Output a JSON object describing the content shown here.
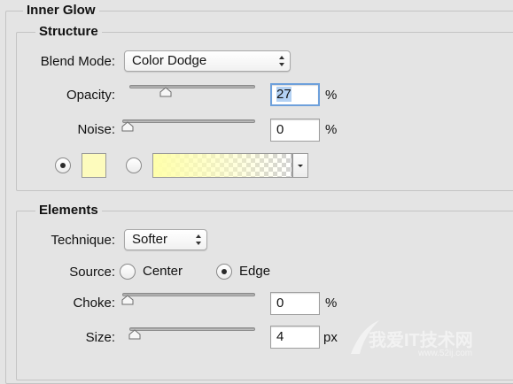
{
  "panel_title": "Inner Glow",
  "structure": {
    "title": "Structure",
    "blend_mode_label": "Blend Mode:",
    "blend_mode_value": "Color Dodge",
    "opacity_label": "Opacity:",
    "opacity_value": "27",
    "opacity_level": 0.27,
    "opacity_unit": "%",
    "noise_label": "Noise:",
    "noise_value": "0",
    "noise_level": 0,
    "noise_unit": "%",
    "color_mode": "solid",
    "glow_color": "#fdfbbd"
  },
  "elements": {
    "title": "Elements",
    "technique_label": "Technique:",
    "technique_value": "Softer",
    "source_label": "Source:",
    "source_center": "Center",
    "source_edge": "Edge",
    "source_selected": "Edge",
    "choke_label": "Choke:",
    "choke_value": "0",
    "choke_unit": "%",
    "size_label": "Size:",
    "size_value": "4",
    "size_unit": "px"
  },
  "watermark": {
    "text": "我爱IT技术网",
    "url": "www.52ij.com"
  }
}
